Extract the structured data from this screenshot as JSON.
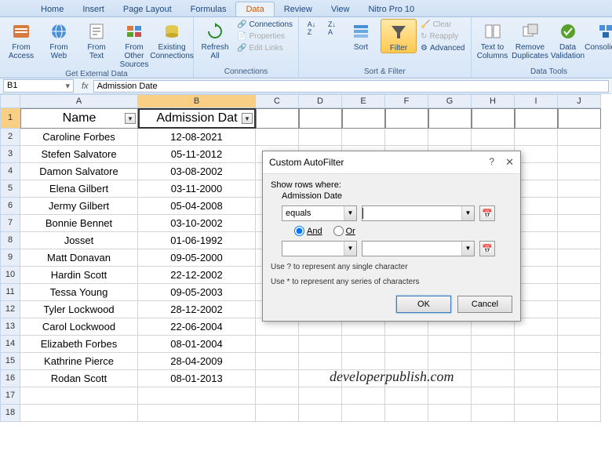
{
  "tabs": [
    "Home",
    "Insert",
    "Page Layout",
    "Formulas",
    "Data",
    "Review",
    "View",
    "Nitro Pro 10"
  ],
  "active_tab": 4,
  "ribbon": {
    "g1": {
      "label": "Get External Data",
      "access": "From\nAccess",
      "web": "From\nWeb",
      "text": "From\nText",
      "other": "From Other\nSources",
      "existing": "Existing\nConnections"
    },
    "g2": {
      "label": "Connections",
      "refresh": "Refresh\nAll",
      "conn": "Connections",
      "prop": "Properties",
      "edit": "Edit Links"
    },
    "g3": {
      "label": "Sort & Filter",
      "sort": "Sort",
      "filter": "Filter",
      "clear": "Clear",
      "reapply": "Reapply",
      "adv": "Advanced"
    },
    "g4": {
      "label": "Data Tools",
      "t2c": "Text to\nColumns",
      "dup": "Remove\nDuplicates",
      "val": "Data\nValidation",
      "cons": "Consolidate"
    }
  },
  "namebox": "B1",
  "fx": "fx",
  "formula": "Admission Date",
  "cols": [
    "A",
    "B",
    "C",
    "D",
    "E",
    "F",
    "G",
    "H",
    "I",
    "J"
  ],
  "headers": {
    "name": "Name",
    "date": "Admission Dat"
  },
  "rows": [
    {
      "n": "Caroline Forbes",
      "d": "12-08-2021"
    },
    {
      "n": "Stefen Salvatore",
      "d": "05-11-2012"
    },
    {
      "n": "Damon Salvatore",
      "d": "03-08-2002"
    },
    {
      "n": "Elena Gilbert",
      "d": "03-11-2000"
    },
    {
      "n": "Jermy Gilbert",
      "d": "05-04-2008"
    },
    {
      "n": "Bonnie Bennet",
      "d": "03-10-2002"
    },
    {
      "n": "Josset",
      "d": "01-06-1992"
    },
    {
      "n": "Matt Donavan",
      "d": "09-05-2000"
    },
    {
      "n": "Hardin Scott",
      "d": "22-12-2002"
    },
    {
      "n": "Tessa Young",
      "d": "09-05-2003"
    },
    {
      "n": "Tyler Lockwood",
      "d": "28-12-2002"
    },
    {
      "n": "Carol Lockwood",
      "d": "22-06-2004"
    },
    {
      "n": "Elizabeth Forbes",
      "d": "08-01-2004"
    },
    {
      "n": "Kathrine Pierce",
      "d": "28-04-2009"
    },
    {
      "n": "Rodan Scott",
      "d": "08-01-2013"
    }
  ],
  "dialog": {
    "title": "Custom AutoFilter",
    "show_where": "Show rows where:",
    "field": "Admission Date",
    "op1": "equals",
    "val1": "",
    "and": "And",
    "or": "Or",
    "op2": "",
    "val2": "",
    "hint1": "Use ? to represent any single character",
    "hint2": "Use * to represent any series of characters",
    "ok": "OK",
    "cancel": "Cancel"
  },
  "watermark": "developerpublish.com"
}
